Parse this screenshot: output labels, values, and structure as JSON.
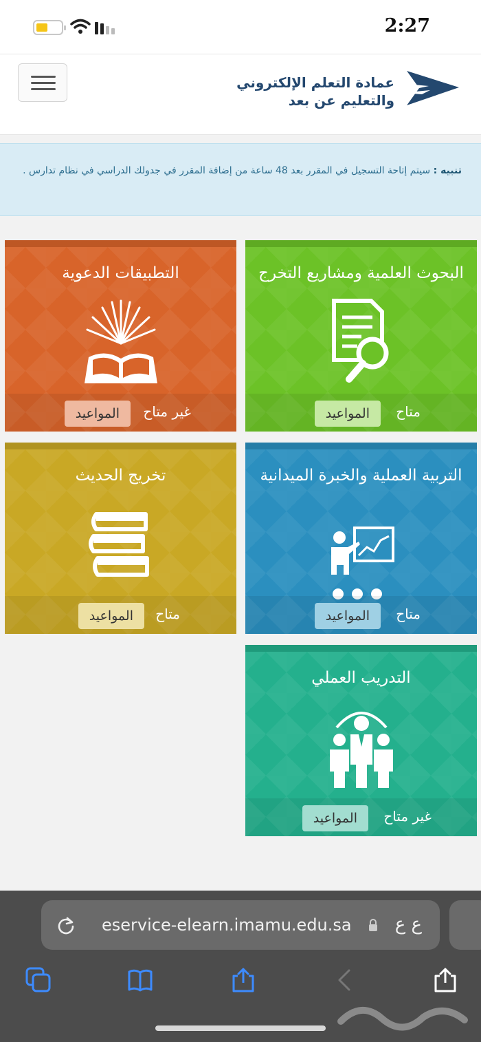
{
  "status_bar": {
    "time": "2:27"
  },
  "header": {
    "logo_line1": "عمادة التعلم الإلكتروني",
    "logo_line2": "والتعليم عن بعد"
  },
  "alert": {
    "label": "تنبيه :",
    "message": "سيتم إتاحة التسجيل في المقرر بعد 48 ساعة من إضافة المقرر في جدولك الدراسي في نظام تدارس ."
  },
  "tiles": [
    {
      "title": "البحوث العلمية ومشاريع التخرج",
      "status": "متاح",
      "button": "المواعيد",
      "color": "#6cc227",
      "icon": "research-search-icon"
    },
    {
      "title": "التطبيقات الدعوية",
      "status": "غير متاح",
      "button": "المواعيد",
      "color": "#d8642a",
      "icon": "open-book-icon"
    },
    {
      "title": "التربية العملية والخبرة الميدانية",
      "status": "متاح",
      "button": "المواعيد",
      "color": "#2b8fbf",
      "icon": "teacher-board-icon"
    },
    {
      "title": "تخريج الحديث",
      "status": "متاح",
      "button": "المواعيد",
      "color": "#c9a825",
      "icon": "books-stack-icon"
    },
    {
      "title": "التدريب العملي",
      "status": "غير متاح",
      "button": "المواعيد",
      "color": "#24b08d",
      "icon": "team-training-icon"
    }
  ],
  "browser": {
    "url": "eservice-elearn.imamu.edu.sa",
    "text_size_label": "ع ع"
  }
}
